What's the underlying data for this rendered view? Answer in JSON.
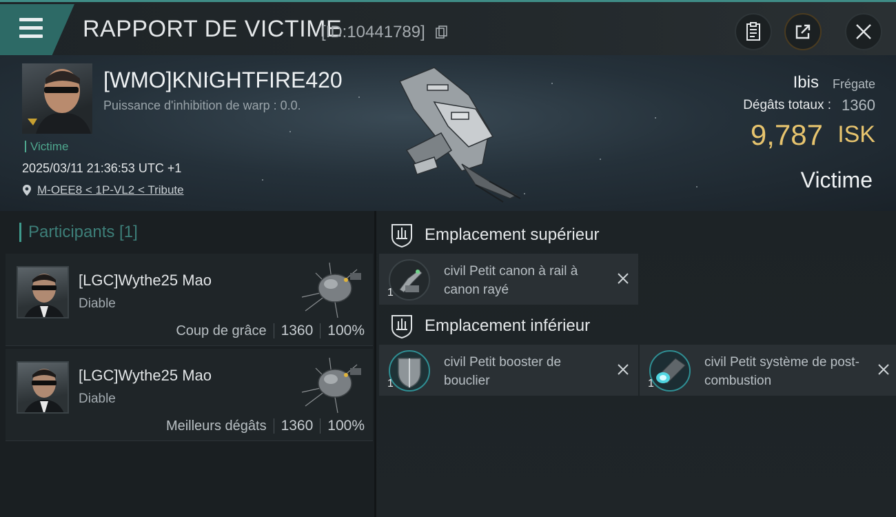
{
  "header": {
    "title": "RAPPORT DE VICTIME",
    "report_id": "[ID:10441789]"
  },
  "victim": {
    "name": "[WMO]KNIGHTFIRE420",
    "warp_disruption": "Puissance d'inhibition de warp : 0.0.",
    "tag": "Victime",
    "datetime": "2025/03/11 21:36:53 UTC +1",
    "location": "M-OEE8 < 1P-VL2 < Tribute",
    "ship_name": "Ibis",
    "ship_class": "Frégate",
    "damage_label": "Dégâts totaux :",
    "damage_value": "1360",
    "isk_value": "9,787",
    "isk_unit": "ISK",
    "role": "Victime"
  },
  "participants": {
    "label": "Participants [1]",
    "items": [
      {
        "name": "[LGC]Wythe25 Mao",
        "ship": "Diable",
        "role": "Coup de grâce",
        "damage": "1360",
        "percent": "100%"
      },
      {
        "name": "[LGC]Wythe25 Mao",
        "ship": "Diable",
        "role": "Meilleurs dégâts",
        "damage": "1360",
        "percent": "100%"
      }
    ]
  },
  "fittings": {
    "high_slot_label": "Emplacement supérieur",
    "low_slot_label": "Emplacement inférieur",
    "high": [
      {
        "name": "civil Petit canon à rail à canon rayé",
        "qty": "1",
        "icon": "railgun-icon"
      }
    ],
    "low": [
      {
        "name": "civil Petit booster de bouclier",
        "qty": "1",
        "icon": "shield-booster-icon"
      },
      {
        "name": "civil Petit système de post-combustion",
        "qty": "1",
        "icon": "afterburner-icon"
      }
    ]
  },
  "colors": {
    "accent_teal": "#3f8c86",
    "isk_gold": "#e7c46e",
    "victim_green": "#4fa88f"
  }
}
